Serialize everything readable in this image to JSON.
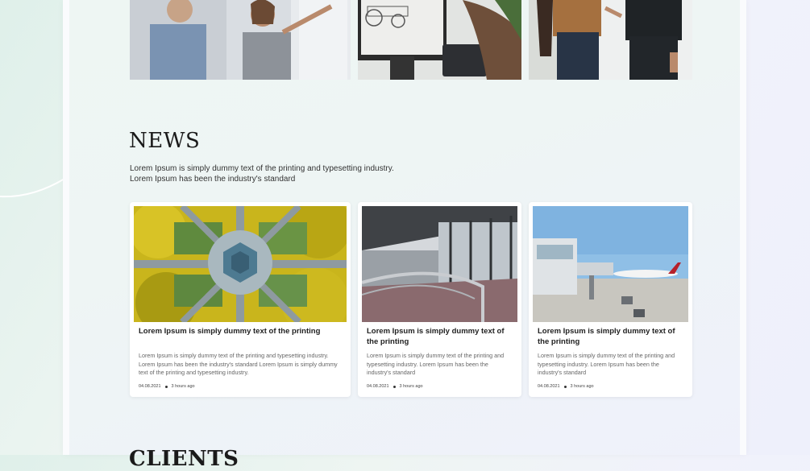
{
  "top_images": [
    {
      "alt": "office-presentation-photo"
    },
    {
      "alt": "engineering-monitor-photo"
    },
    {
      "alt": "team-discussion-photo"
    }
  ],
  "news": {
    "title": "NEWS",
    "description_line1": "Lorem Ipsum is simply dummy text of the printing and typesetting industry.",
    "description_line2": "Lorem Ipsum has been the industry's standard"
  },
  "cards": [
    {
      "title": "Lorem Ipsum is simply dummy text of the printing",
      "text": "Lorem Ipsum is simply dummy text of the printing and typesetting industry. Lorem Ipsum has been the industry's standard Lorem Ipsum is simply dummy text of the printing and typesetting industry.",
      "date": "04.08.2021",
      "time_ago": "3 hours ago"
    },
    {
      "title": "Lorem Ipsum is simply dummy text of the printing",
      "text": "Lorem Ipsum is simply dummy text of the printing and typesetting industry. Lorem Ipsum has been the industry's standard",
      "date": "04.08.2021",
      "time_ago": "3 hours ago"
    },
    {
      "title": "Lorem Ipsum is simply dummy text of the printing",
      "text": "Lorem Ipsum is simply dummy text of the printing and typesetting industry. Lorem Ipsum has been the industry's standard",
      "date": "04.08.2021",
      "time_ago": "3 hours ago"
    }
  ],
  "clients": {
    "title": "CLIENTS"
  },
  "colors": {
    "accent": "#1a1a1a",
    "card_bg": "#ffffff"
  }
}
